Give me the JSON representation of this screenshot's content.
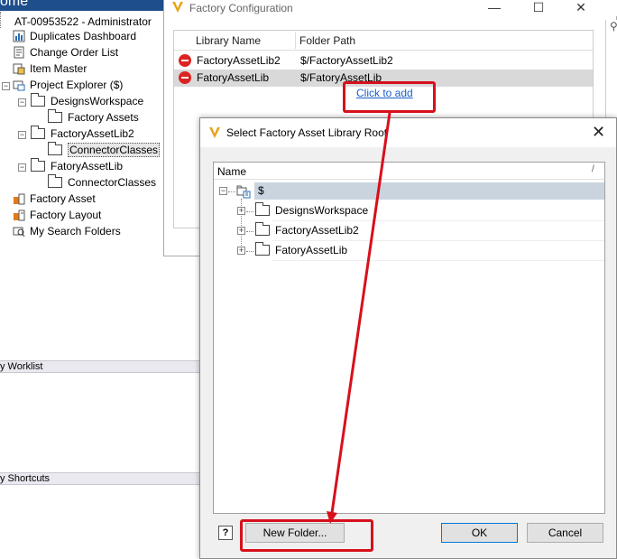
{
  "background_app": {
    "home_label": "ome",
    "connection_label": "AT-00953522 - Administrator",
    "tree_items": [
      {
        "label": "Duplicates Dashboard",
        "icon": "dashboard-icon"
      },
      {
        "label": "Change Order List",
        "icon": "document-icon"
      },
      {
        "label": "Item Master",
        "icon": "item-master-icon"
      },
      {
        "label": "Project Explorer ($)",
        "icon": "project-explorer-icon"
      },
      {
        "label": "DesignsWorkspace",
        "icon": "folder-icon"
      },
      {
        "label": "Factory Assets",
        "icon": "folder-icon"
      },
      {
        "label": "FactoryAssetLib2",
        "icon": "folder-icon"
      },
      {
        "label": "ConnectorClasses",
        "icon": "folder-icon"
      },
      {
        "label": "FatoryAssetLib",
        "icon": "folder-icon"
      },
      {
        "label": "ConnectorClasses",
        "icon": "folder-icon"
      },
      {
        "label": "Factory Asset",
        "icon": "factory-asset-icon"
      },
      {
        "label": "Factory Layout",
        "icon": "factory-layout-icon"
      },
      {
        "label": "My Search Folders",
        "icon": "search-folder-icon"
      }
    ],
    "worklist_label": "y Worklist",
    "shortcuts_label": "y Shortcuts"
  },
  "factory_config": {
    "title": "Factory Configuration",
    "minimize": "—",
    "maximize": "☐",
    "close": "✕",
    "columns": [
      "Library Name",
      "Folder Path"
    ],
    "rows": [
      {
        "name": "FactoryAssetLib2",
        "path": "$/FactoryAssetLib2",
        "selected": false
      },
      {
        "name": "FatoryAssetLib",
        "path": "$/FatoryAssetLib",
        "selected": true
      }
    ],
    "add_link": "Click to add"
  },
  "dialog": {
    "title": "Select Factory Asset Library Root",
    "close": "✕",
    "column_name": "Name",
    "sort_glyph": "/",
    "root": "$",
    "children": [
      "DesignsWorkspace",
      "FactoryAssetLib2",
      "FatoryAssetLib"
    ],
    "help": "?",
    "new_folder": "New Folder...",
    "ok": "OK",
    "cancel": "Cancel"
  },
  "colors": {
    "annotation_red": "#d7101c",
    "link_blue": "#1a5fc9",
    "selection_blue": "#c9d4de"
  }
}
